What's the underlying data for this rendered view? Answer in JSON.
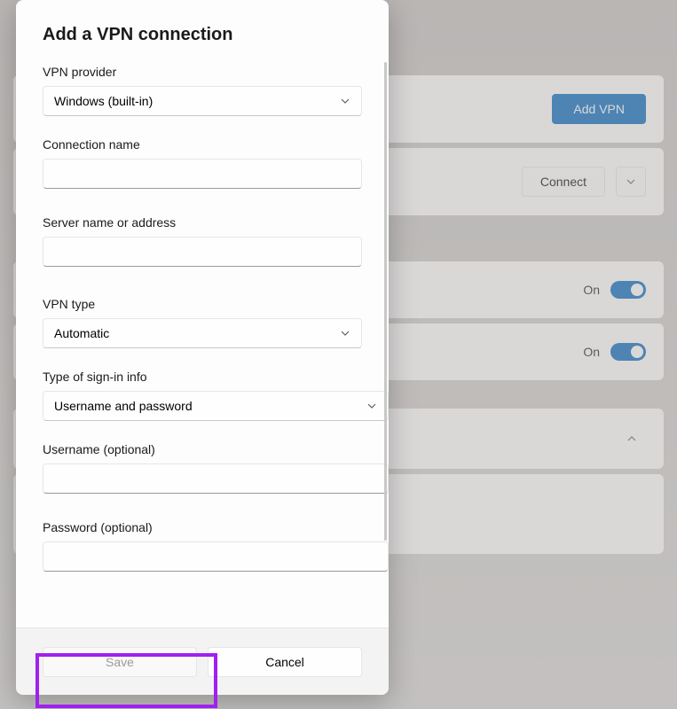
{
  "dialog": {
    "title": "Add a VPN connection",
    "fields": {
      "provider": {
        "label": "VPN provider",
        "value": "Windows (built-in)"
      },
      "connection_name": {
        "label": "Connection name",
        "value": ""
      },
      "server": {
        "label": "Server name or address",
        "value": ""
      },
      "vpn_type": {
        "label": "VPN type",
        "value": "Automatic"
      },
      "signin_type": {
        "label": "Type of sign-in info",
        "value": "Username and password"
      },
      "username": {
        "label": "Username (optional)",
        "value": ""
      },
      "password": {
        "label": "Password (optional)",
        "value": ""
      }
    },
    "buttons": {
      "save": "Save",
      "cancel": "Cancel"
    }
  },
  "background": {
    "add_vpn": "Add VPN",
    "connect": "Connect",
    "toggle1": "On",
    "toggle2": "On"
  }
}
